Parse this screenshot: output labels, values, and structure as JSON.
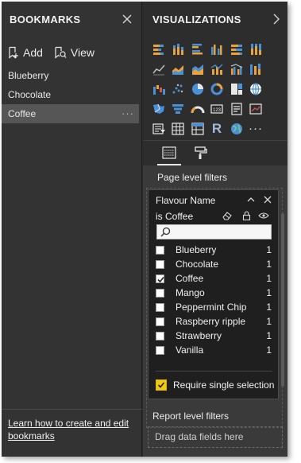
{
  "bookmarks": {
    "title": "BOOKMARKS",
    "add_label": "Add",
    "view_label": "View",
    "items": [
      {
        "label": "Blueberry",
        "selected": false
      },
      {
        "label": "Chocolate",
        "selected": false
      },
      {
        "label": "Coffee",
        "selected": true
      }
    ],
    "more_glyph": "···",
    "footer_link_line1": "Learn how to create and edit",
    "footer_link_line2": "bookmarks"
  },
  "visualizations": {
    "title": "VISUALIZATIONS",
    "icons": [
      [
        "stacked-bar-chart-icon",
        "stacked-column-chart-icon",
        "clustered-bar-chart-icon",
        "clustered-column-chart-icon",
        "100pct-stacked-bar-chart-icon",
        "100pct-stacked-column-chart-icon"
      ],
      [
        "line-chart-icon",
        "area-chart-icon",
        "stacked-area-chart-icon",
        "line-and-stacked-column-icon",
        "line-and-clustered-column-icon",
        "ribbon-chart-icon"
      ],
      [
        "waterfall-chart-icon",
        "scatter-chart-icon",
        "pie-chart-icon",
        "donut-chart-icon",
        "treemap-icon",
        "map-icon"
      ],
      [
        "filled-map-icon",
        "funnel-icon",
        "gauge-icon",
        "card-icon",
        "multi-row-card-icon",
        "kpi-icon"
      ],
      [
        "slicer-icon",
        "table-icon",
        "matrix-icon",
        "r-visual-icon",
        "globe-icon",
        "more-visuals-icon"
      ]
    ],
    "r_glyph": "R",
    "more_glyph": "···"
  },
  "filters": {
    "page_level_label": "Page level filters",
    "card": {
      "field_name": "Flavour Name",
      "condition": "is Coffee",
      "search_value": "",
      "values": [
        {
          "name": "Blueberry",
          "count": "1",
          "checked": false
        },
        {
          "name": "Chocolate",
          "count": "1",
          "checked": false
        },
        {
          "name": "Coffee",
          "count": "1",
          "checked": true
        },
        {
          "name": "Mango",
          "count": "1",
          "checked": false
        },
        {
          "name": "Peppermint Chip",
          "count": "1",
          "checked": false
        },
        {
          "name": "Raspberry ripple",
          "count": "1",
          "checked": false
        },
        {
          "name": "Strawberry",
          "count": "1",
          "checked": false
        },
        {
          "name": "Vanilla",
          "count": "1",
          "checked": false
        }
      ],
      "require_single_selection_label": "Require single selection",
      "require_single_selection": true
    },
    "report_level_label": "Report level filters",
    "drop_placeholder": "Drag data fields here"
  },
  "colors": {
    "accent_yellow": "#f2c811",
    "pane_dark": "#2d2d2d",
    "selected_row": "#565656"
  }
}
